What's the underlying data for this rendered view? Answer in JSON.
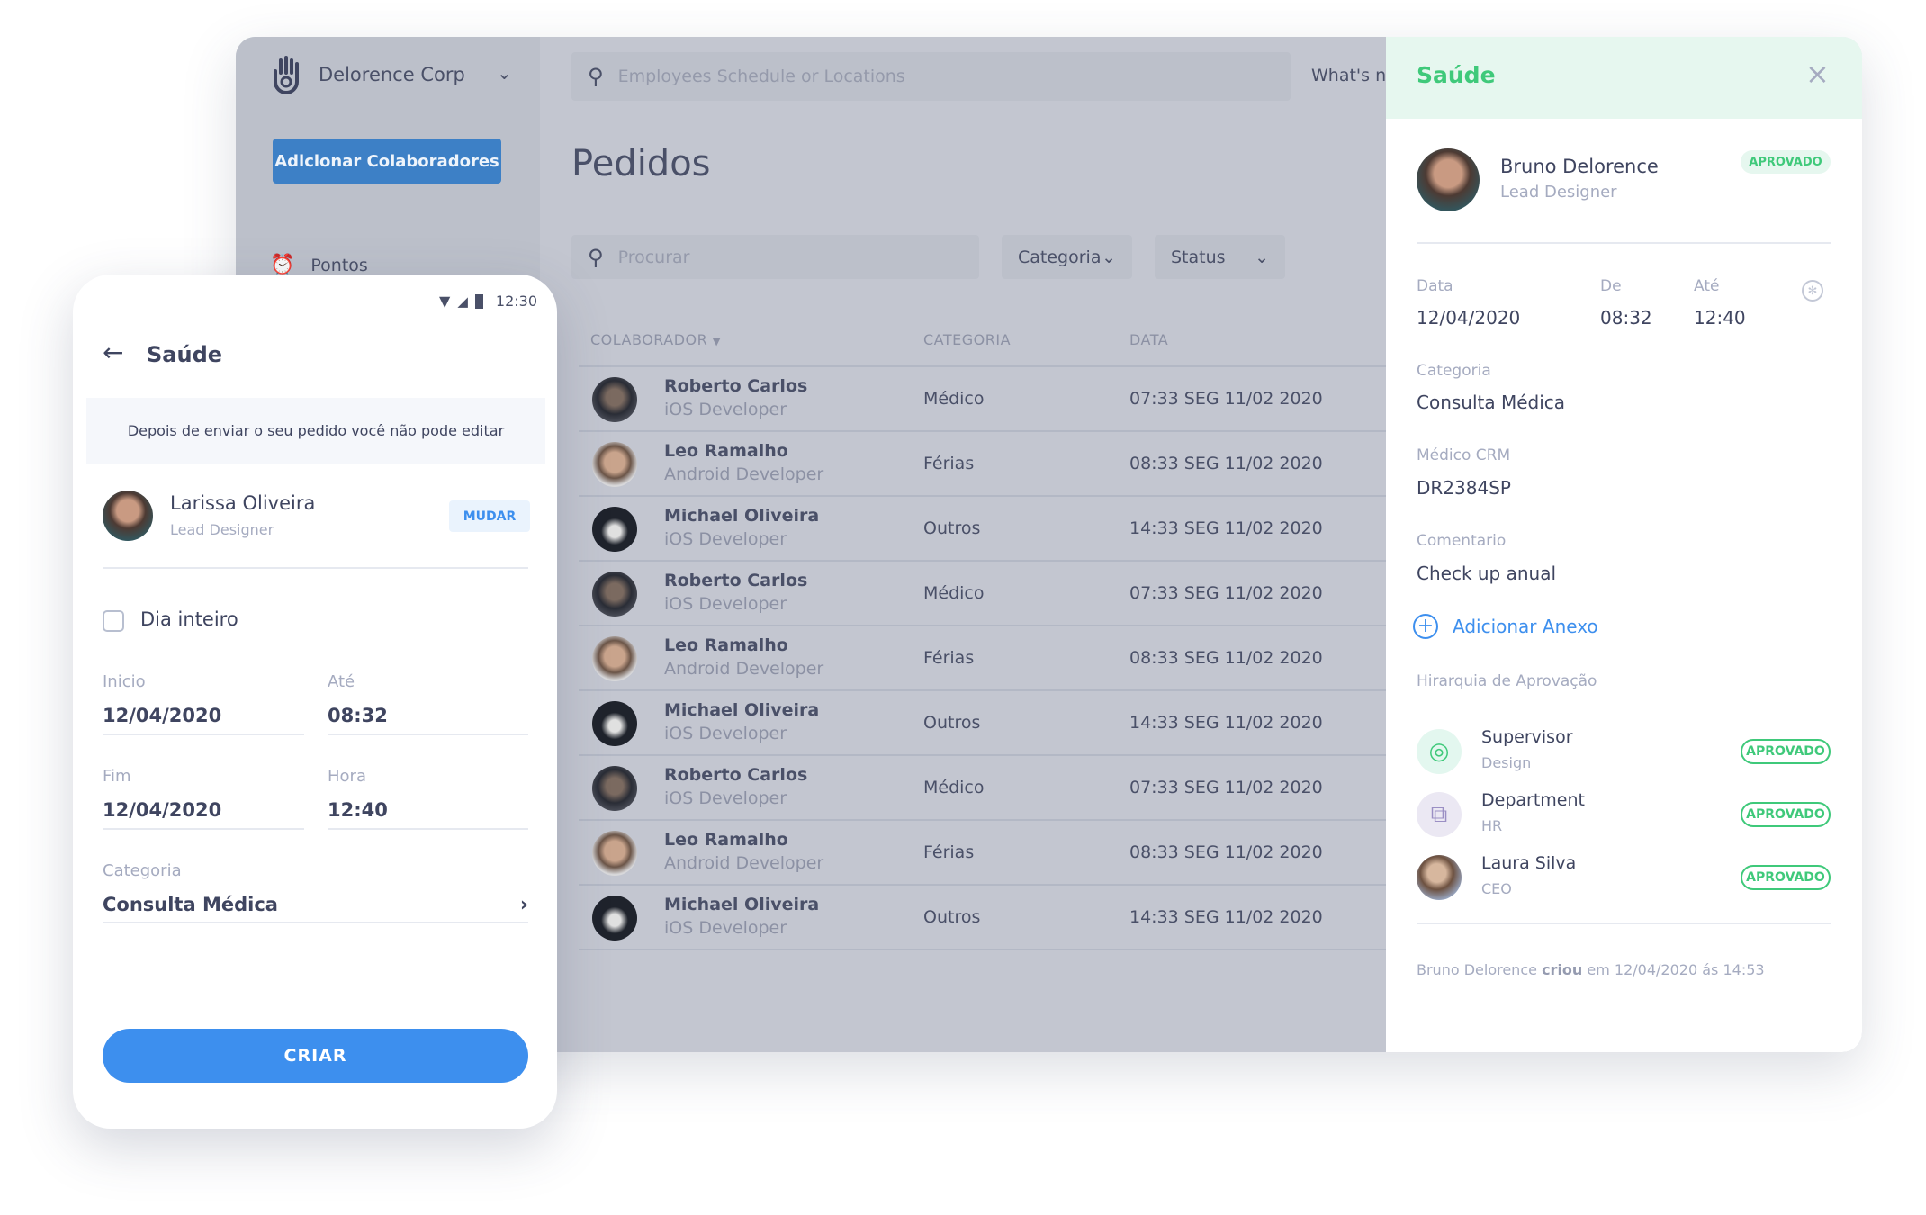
{
  "dashboard": {
    "company": "Delorence Corp",
    "add_button": "Adicionar Colaboradores",
    "sidebar_items": [
      {
        "label": "Pontos",
        "icon": "alarm-clock-icon"
      }
    ],
    "search_placeholder": "Employees Schedule or Locations",
    "whats_new": "What's ne",
    "page_title": "Pedidos",
    "filter_placeholder": "Procurar",
    "filter_category": "Categoria",
    "filter_status": "Status",
    "columns": [
      "COLABORADOR",
      "CATEGORIA",
      "DATA"
    ],
    "rows": [
      {
        "name": "Roberto Carlos",
        "role": "iOS Developer",
        "category": "Médico",
        "date": "07:33 SEG 11/02 2020"
      },
      {
        "name": "Leo Ramalho",
        "role": "Android Developer",
        "category": "Férias",
        "date": "08:33 SEG 11/02 2020"
      },
      {
        "name": "Michael Oliveira",
        "role": "iOS Developer",
        "category": "Outros",
        "date": "14:33 SEG 11/02 2020"
      },
      {
        "name": "Roberto Carlos",
        "role": "iOS Developer",
        "category": "Médico",
        "date": "07:33 SEG 11/02 2020"
      },
      {
        "name": "Leo Ramalho",
        "role": "Android Developer",
        "category": "Férias",
        "date": "08:33 SEG 11/02 2020"
      },
      {
        "name": "Michael Oliveira",
        "role": "iOS Developer",
        "category": "Outros",
        "date": "14:33 SEG 11/02 2020"
      },
      {
        "name": "Roberto Carlos",
        "role": "iOS Developer",
        "category": "Médico",
        "date": "07:33 SEG 11/02 2020"
      },
      {
        "name": "Leo Ramalho",
        "role": "Android Developer",
        "category": "Férias",
        "date": "08:33 SEG 11/02 2020"
      },
      {
        "name": "Michael Oliveira",
        "role": "iOS Developer",
        "category": "Outros",
        "date": "14:33 SEG 11/02 2020"
      }
    ]
  },
  "panel": {
    "title": "Saúde",
    "user_name": "Bruno Delorence",
    "user_role": "Lead Designer",
    "status": "APROVADO",
    "date_label": "Data",
    "date": "12/04/2020",
    "from_label": "De",
    "from": "08:32",
    "to_label": "Até",
    "to": "12:40",
    "category_label": "Categoria",
    "category": "Consulta Médica",
    "crm_label": "Médico CRM",
    "crm": "DR2384SP",
    "comment_label": "Comentario",
    "comment": "Check up anual",
    "attach": "Adicionar Anexo",
    "hierarchy_label": "Hirarquia de Aprovação",
    "hierarchy": [
      {
        "name": "Supervisor",
        "sub": "Design",
        "status": "APROVADO",
        "icon": "target-icon"
      },
      {
        "name": "Department",
        "sub": "HR",
        "status": "APROVADO",
        "icon": "org-chart-icon"
      },
      {
        "name": "Laura Silva",
        "sub": "CEO",
        "status": "APROVADO",
        "icon": "avatar"
      }
    ],
    "footer_name": "Bruno Delorence",
    "footer_action": "criou",
    "footer_rest": "em 12/04/2020 ás 14:53"
  },
  "mobile": {
    "time": "12:30",
    "title": "Saúde",
    "notice": "Depois de enviar o seu pedido você não pode editar",
    "user_name": "Larissa Oliveira",
    "user_role": "Lead Designer",
    "change": "MUDAR",
    "all_day": "Dia inteiro",
    "start_label": "Inicio",
    "start": "12/04/2020",
    "until_label": "Até",
    "until": "08:32",
    "end_label": "Fim",
    "end": "12/04/2020",
    "hour_label": "Hora",
    "hour": "12:40",
    "category_label": "Categoria",
    "category": "Consulta Médica",
    "create": "CRIAR"
  },
  "colors": {
    "accent_blue": "#3d8fee",
    "success_green": "#3fc97a",
    "panel_header": "#e6f7ef"
  }
}
